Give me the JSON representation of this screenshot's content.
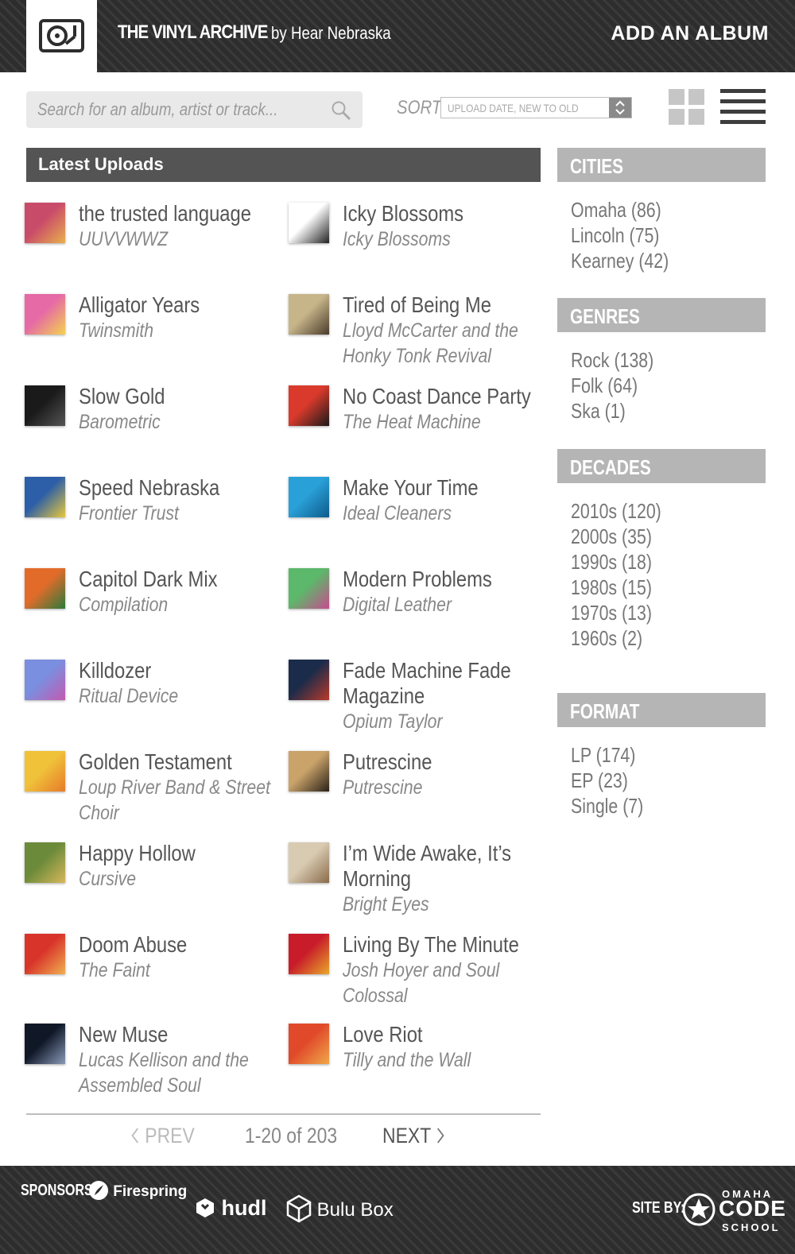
{
  "header": {
    "title": "THE VINYL ARCHIVE",
    "byline": "by Hear Nebraska",
    "add_album": "ADD AN ALBUM"
  },
  "toolbar": {
    "search_placeholder": "Search for an album, artist or track...",
    "sort_label": "SORT",
    "sort_value": "UPLOAD DATE, NEW TO OLD"
  },
  "main": {
    "section_title": "Latest Uploads",
    "albums": [
      {
        "title": "the trusted language",
        "artist": "UUVVWWZ",
        "cover": [
          "#c94b6a",
          "#e8b04c"
        ]
      },
      {
        "title": "Icky Blossoms",
        "artist": "Icky Blossoms",
        "cover": [
          "#ffffff",
          "#222222"
        ]
      },
      {
        "title": "Alligator Years",
        "artist": "Twinsmith",
        "cover": [
          "#e56aa6",
          "#f4d24e"
        ]
      },
      {
        "title": "Tired of Being Me",
        "artist": "Lloyd McCarter and the Honky Tonk Revival",
        "cover": [
          "#c7b58a",
          "#4a3b2a"
        ]
      },
      {
        "title": "Slow Gold",
        "artist": "Barometric",
        "cover": [
          "#1a1a1a",
          "#555555"
        ]
      },
      {
        "title": "No Coast Dance Party",
        "artist": "The Heat Machine",
        "cover": [
          "#d93a2b",
          "#1a1a1a"
        ]
      },
      {
        "title": "Speed Nebraska",
        "artist": "Frontier Trust",
        "cover": [
          "#2d5fa8",
          "#e8c83a"
        ]
      },
      {
        "title": "Make Your Time",
        "artist": "Ideal Cleaners",
        "cover": [
          "#2aa0d8",
          "#0d5a8a"
        ]
      },
      {
        "title": "Capitol Dark Mix",
        "artist": "Compilation",
        "cover": [
          "#e36b2a",
          "#2b7a3a"
        ]
      },
      {
        "title": "Modern Problems",
        "artist": "Digital Leather",
        "cover": [
          "#5cb86a",
          "#c84c8e"
        ]
      },
      {
        "title": "Killdozer",
        "artist": "Ritual Device",
        "cover": [
          "#7a8fe0",
          "#c25ab0"
        ]
      },
      {
        "title": "Fade Machine Fade Magazine",
        "artist": "Opium Taylor",
        "cover": [
          "#1b2b4a",
          "#b83a2a"
        ]
      },
      {
        "title": "Golden Testament",
        "artist": "Loup River Band & Street Choir",
        "cover": [
          "#f0c23a",
          "#e67a2a"
        ]
      },
      {
        "title": "Putrescine",
        "artist": "Putrescine",
        "cover": [
          "#c9a36a",
          "#2a2118"
        ]
      },
      {
        "title": "Happy Hollow",
        "artist": "Cursive",
        "cover": [
          "#6b8a3a",
          "#d8b85a"
        ]
      },
      {
        "title": "I’m Wide Awake, It’s Morning",
        "artist": "Bright Eyes",
        "cover": [
          "#d8cbb2",
          "#8a6a4a"
        ]
      },
      {
        "title": "Doom Abuse",
        "artist": "The Faint",
        "cover": [
          "#d8342a",
          "#f0b050"
        ]
      },
      {
        "title": "Living By The Minute",
        "artist": "Josh Hoyer and Soul Colossal",
        "cover": [
          "#c81c2a",
          "#e8a82a"
        ]
      },
      {
        "title": "New Muse",
        "artist": "Lucas Kellison and the Assembled Soul",
        "cover": [
          "#101828",
          "#8a9ab8"
        ]
      },
      {
        "title": "Love Riot",
        "artist": "Tilly and the Wall",
        "cover": [
          "#e04a2a",
          "#f0a84a"
        ]
      }
    ],
    "pagination": {
      "prev": "PREV",
      "count": "1-20 of 203",
      "next": "NEXT"
    }
  },
  "sidebar": {
    "cities": {
      "title": "CITIES",
      "items": [
        "Omaha (86)",
        "Lincoln (75)",
        "Kearney (42)"
      ]
    },
    "genres": {
      "title": "GENRES",
      "items": [
        "Rock (138)",
        "Folk (64)",
        "Ska (1)"
      ]
    },
    "decades": {
      "title": "DECADES",
      "items": [
        "2010s (120)",
        "2000s (35)",
        "1990s (18)",
        "1980s (15)",
        "1970s (13)",
        "1960s (2)"
      ]
    },
    "format": {
      "title": "FORMAT",
      "items": [
        "LP (174)",
        "EP (23)",
        "Single (7)"
      ]
    }
  },
  "footer": {
    "sponsors_label": "SPONSORS:",
    "sponsors": [
      "Firespring",
      "hudl",
      "Bulu Box"
    ],
    "siteby_label": "SITE BY:",
    "siteby_top": "OMAHA",
    "siteby_mid": "CODE",
    "siteby_bottom": "SCHOOL"
  }
}
